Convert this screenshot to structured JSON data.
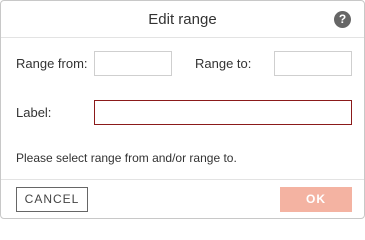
{
  "dialog": {
    "title": "Edit range",
    "help_icon": "?"
  },
  "form": {
    "range_from_label": "Range from:",
    "range_from_value": "",
    "range_to_label": "Range to:",
    "range_to_value": "",
    "label_label": "Label:",
    "label_value": ""
  },
  "message": "Please select range from and/or range to.",
  "buttons": {
    "cancel": "CANCEL",
    "ok": "OK"
  },
  "colors": {
    "ok_button_bg": "#f4b3a2",
    "label_input_error_border": "#8b1a1a",
    "help_icon_bg": "#666666"
  }
}
